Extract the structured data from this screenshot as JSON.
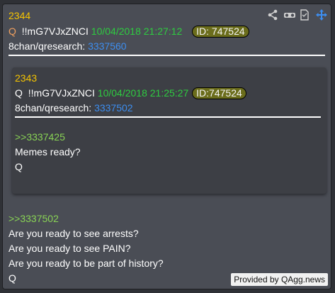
{
  "post": {
    "number": "2344",
    "author_prefix": "Q",
    "tripcode": "!!mG7VJxZNCI",
    "timestamp": "10/04/2018 21:27:12",
    "id_badge": "ID: 747524",
    "source_prefix": "8chan/qresearch:",
    "source_link": "3337560",
    "reply_ref": ">>3337502",
    "lines": [
      "Are you ready to see arrests?",
      "Are you ready to see PAIN?",
      "Are you ready to be part of history?",
      "Q"
    ]
  },
  "quoted": {
    "number": "2343",
    "author_prefix": "Q",
    "tripcode": "!!mG7VJxZNCI",
    "timestamp": "10/04/2018 21:25:27",
    "id_badge": "ID:747524",
    "source_prefix": "8chan/qresearch:",
    "source_link": "3337502",
    "reply_ref": ">>3337425",
    "lines": [
      "Memes ready?",
      "Q"
    ]
  },
  "toolbar": {
    "icons": [
      "share-icon",
      "glasses-icon",
      "document-icon",
      "move-icon"
    ]
  },
  "footer": {
    "label": "Provided by QAgg.news"
  },
  "colors": {
    "background": "#4a4d55",
    "inner_background": "#3d3f45",
    "post_number": "#f5c400",
    "timestamp": "#2ecc40",
    "link": "#3d8ef0",
    "quote_ref": "#89d455",
    "id_badge": "#6b6d1c"
  }
}
